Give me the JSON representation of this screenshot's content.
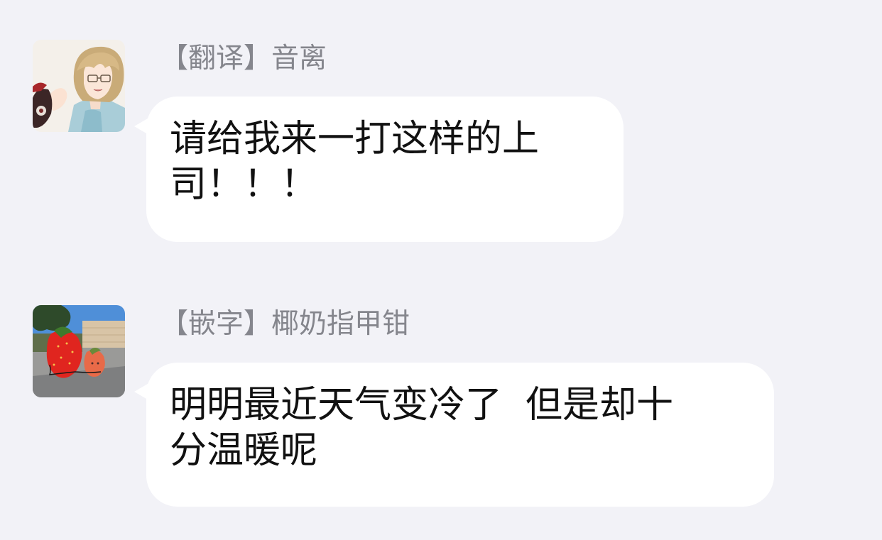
{
  "messages": [
    {
      "sender": "【翻译】音离",
      "lines": [
        "请给我来一打这样的上",
        "司！！！"
      ],
      "avatar_icon": "anime-character-avatar"
    },
    {
      "sender": "【嵌字】椰奶指甲钳",
      "lines": [
        "明明最近天气变冷了  但是却十",
        "分温暖呢"
      ],
      "avatar_icon": "strawberry-photo-avatar"
    }
  ],
  "colors": {
    "background": "#f2f2f7",
    "bubble": "#ffffff",
    "sender_text": "#85868d",
    "message_text": "#111111"
  }
}
